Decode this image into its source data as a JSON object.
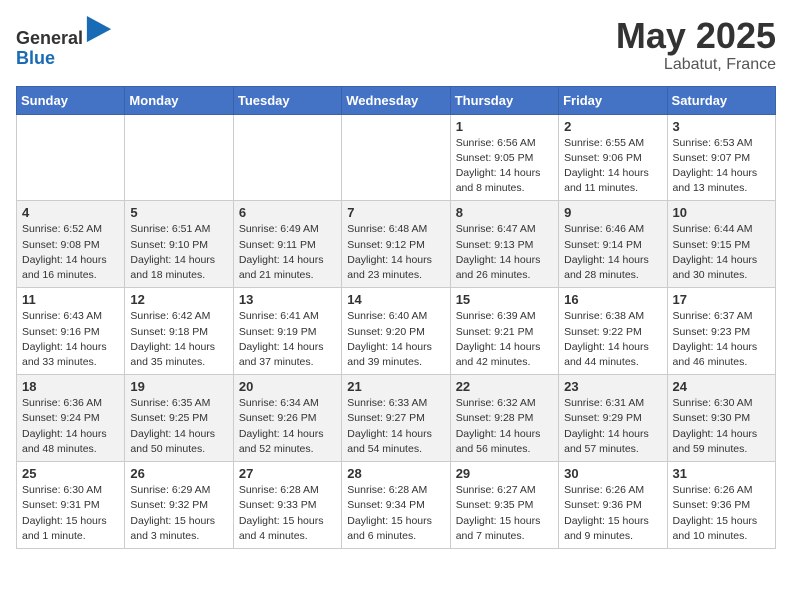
{
  "header": {
    "logo_general": "General",
    "logo_blue": "Blue",
    "month_title": "May 2025",
    "location": "Labatut, France"
  },
  "days_of_week": [
    "Sunday",
    "Monday",
    "Tuesday",
    "Wednesday",
    "Thursday",
    "Friday",
    "Saturday"
  ],
  "weeks": [
    [
      {
        "day": "",
        "info": ""
      },
      {
        "day": "",
        "info": ""
      },
      {
        "day": "",
        "info": ""
      },
      {
        "day": "",
        "info": ""
      },
      {
        "day": "1",
        "info": "Sunrise: 6:56 AM\nSunset: 9:05 PM\nDaylight: 14 hours\nand 8 minutes."
      },
      {
        "day": "2",
        "info": "Sunrise: 6:55 AM\nSunset: 9:06 PM\nDaylight: 14 hours\nand 11 minutes."
      },
      {
        "day": "3",
        "info": "Sunrise: 6:53 AM\nSunset: 9:07 PM\nDaylight: 14 hours\nand 13 minutes."
      }
    ],
    [
      {
        "day": "4",
        "info": "Sunrise: 6:52 AM\nSunset: 9:08 PM\nDaylight: 14 hours\nand 16 minutes."
      },
      {
        "day": "5",
        "info": "Sunrise: 6:51 AM\nSunset: 9:10 PM\nDaylight: 14 hours\nand 18 minutes."
      },
      {
        "day": "6",
        "info": "Sunrise: 6:49 AM\nSunset: 9:11 PM\nDaylight: 14 hours\nand 21 minutes."
      },
      {
        "day": "7",
        "info": "Sunrise: 6:48 AM\nSunset: 9:12 PM\nDaylight: 14 hours\nand 23 minutes."
      },
      {
        "day": "8",
        "info": "Sunrise: 6:47 AM\nSunset: 9:13 PM\nDaylight: 14 hours\nand 26 minutes."
      },
      {
        "day": "9",
        "info": "Sunrise: 6:46 AM\nSunset: 9:14 PM\nDaylight: 14 hours\nand 28 minutes."
      },
      {
        "day": "10",
        "info": "Sunrise: 6:44 AM\nSunset: 9:15 PM\nDaylight: 14 hours\nand 30 minutes."
      }
    ],
    [
      {
        "day": "11",
        "info": "Sunrise: 6:43 AM\nSunset: 9:16 PM\nDaylight: 14 hours\nand 33 minutes."
      },
      {
        "day": "12",
        "info": "Sunrise: 6:42 AM\nSunset: 9:18 PM\nDaylight: 14 hours\nand 35 minutes."
      },
      {
        "day": "13",
        "info": "Sunrise: 6:41 AM\nSunset: 9:19 PM\nDaylight: 14 hours\nand 37 minutes."
      },
      {
        "day": "14",
        "info": "Sunrise: 6:40 AM\nSunset: 9:20 PM\nDaylight: 14 hours\nand 39 minutes."
      },
      {
        "day": "15",
        "info": "Sunrise: 6:39 AM\nSunset: 9:21 PM\nDaylight: 14 hours\nand 42 minutes."
      },
      {
        "day": "16",
        "info": "Sunrise: 6:38 AM\nSunset: 9:22 PM\nDaylight: 14 hours\nand 44 minutes."
      },
      {
        "day": "17",
        "info": "Sunrise: 6:37 AM\nSunset: 9:23 PM\nDaylight: 14 hours\nand 46 minutes."
      }
    ],
    [
      {
        "day": "18",
        "info": "Sunrise: 6:36 AM\nSunset: 9:24 PM\nDaylight: 14 hours\nand 48 minutes."
      },
      {
        "day": "19",
        "info": "Sunrise: 6:35 AM\nSunset: 9:25 PM\nDaylight: 14 hours\nand 50 minutes."
      },
      {
        "day": "20",
        "info": "Sunrise: 6:34 AM\nSunset: 9:26 PM\nDaylight: 14 hours\nand 52 minutes."
      },
      {
        "day": "21",
        "info": "Sunrise: 6:33 AM\nSunset: 9:27 PM\nDaylight: 14 hours\nand 54 minutes."
      },
      {
        "day": "22",
        "info": "Sunrise: 6:32 AM\nSunset: 9:28 PM\nDaylight: 14 hours\nand 56 minutes."
      },
      {
        "day": "23",
        "info": "Sunrise: 6:31 AM\nSunset: 9:29 PM\nDaylight: 14 hours\nand 57 minutes."
      },
      {
        "day": "24",
        "info": "Sunrise: 6:30 AM\nSunset: 9:30 PM\nDaylight: 14 hours\nand 59 minutes."
      }
    ],
    [
      {
        "day": "25",
        "info": "Sunrise: 6:30 AM\nSunset: 9:31 PM\nDaylight: 15 hours\nand 1 minute."
      },
      {
        "day": "26",
        "info": "Sunrise: 6:29 AM\nSunset: 9:32 PM\nDaylight: 15 hours\nand 3 minutes."
      },
      {
        "day": "27",
        "info": "Sunrise: 6:28 AM\nSunset: 9:33 PM\nDaylight: 15 hours\nand 4 minutes."
      },
      {
        "day": "28",
        "info": "Sunrise: 6:28 AM\nSunset: 9:34 PM\nDaylight: 15 hours\nand 6 minutes."
      },
      {
        "day": "29",
        "info": "Sunrise: 6:27 AM\nSunset: 9:35 PM\nDaylight: 15 hours\nand 7 minutes."
      },
      {
        "day": "30",
        "info": "Sunrise: 6:26 AM\nSunset: 9:36 PM\nDaylight: 15 hours\nand 9 minutes."
      },
      {
        "day": "31",
        "info": "Sunrise: 6:26 AM\nSunset: 9:36 PM\nDaylight: 15 hours\nand 10 minutes."
      }
    ]
  ]
}
